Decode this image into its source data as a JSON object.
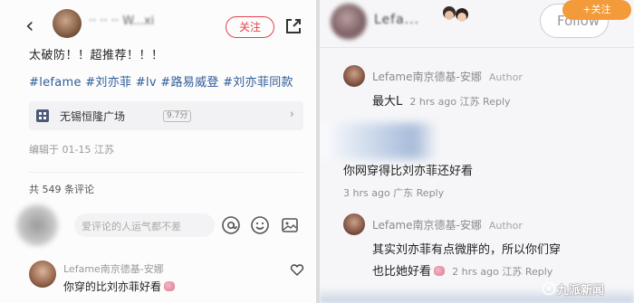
{
  "left": {
    "back_icon": "chevron-left-icon",
    "username": "·· ·· ·· W...xi",
    "follow_label": "关注",
    "share_icon": "share-icon",
    "post_text": "太破防！！超推荐！！！",
    "tags": "#lefame #刘亦菲 #lv #路易威登 #刘亦菲同款",
    "location": {
      "name": "无锡恒隆广场",
      "rating": "9.7分",
      "arrow": "›"
    },
    "edit_meta": "编辑于 01-15 江苏",
    "comment_count": "共 549 条评论",
    "comment_input_placeholder": "爱评论的人运气都不差",
    "icons": [
      "at-icon",
      "smile-icon",
      "image-icon"
    ],
    "first_comment": {
      "name": "Lefame南京德基-安娜",
      "text": "你穿的比刘亦菲好看"
    }
  },
  "right": {
    "username": "Lefa...",
    "follow_label": "Follow",
    "follow_orange_label": "+关注",
    "comments": [
      {
        "name": "Lefame南京德基-安娜",
        "author_tag": "Author",
        "text": "最大L",
        "meta": "2 hrs ago 江苏 Reply"
      },
      {
        "name": "",
        "text": "你网穿得比刘亦菲还好看",
        "meta": "3 hrs ago 广东 Reply"
      },
      {
        "name": "Lefame南京德基-安娜",
        "author_tag": "Author",
        "text_line1": "其实刘亦菲有点微胖的，所以你们穿",
        "text_line2": "也比她好看",
        "meta": "2 hrs ago 江苏 Reply"
      }
    ]
  },
  "watermark": "九派新闻",
  "colors": {
    "accent_red": "#e5404f",
    "tag_blue": "#2e5b99",
    "orange": "#f39a3a"
  }
}
